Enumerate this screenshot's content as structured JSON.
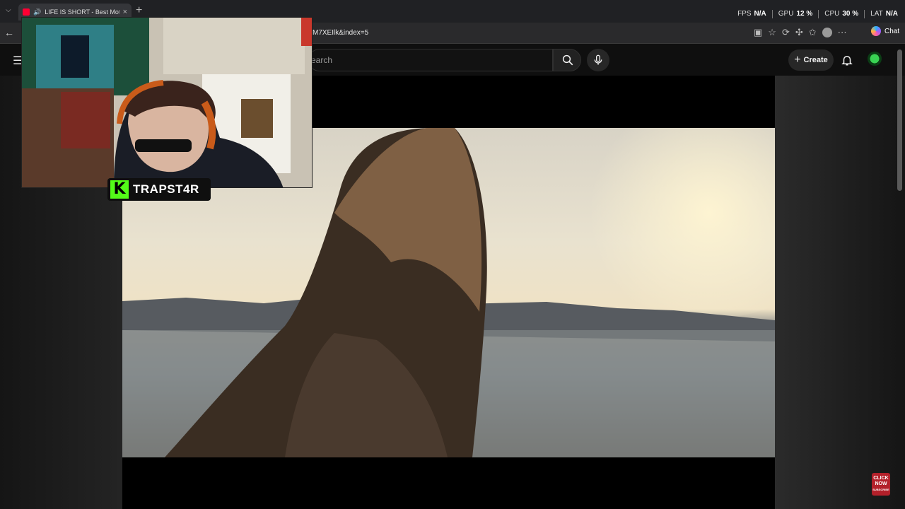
{
  "browser": {
    "tab_title": "LIFE IS SHORT - Best Motivati",
    "tab_close": "×",
    "new_tab": "+",
    "tab_list": "⌵",
    "url_fragment": "M7XEIlk&index=5",
    "chat_label": "Chat"
  },
  "perf_overlay": {
    "fps_label": "FPS",
    "fps_value": "N/A",
    "gpu_label": "GPU",
    "gpu_value": "12 %",
    "cpu_label": "CPU",
    "cpu_value": "30 %",
    "lat_label": "LAT",
    "lat_value": "N/A"
  },
  "youtube": {
    "search_placeholder": "earch",
    "create_label": "Create",
    "icons": [
      "menu-icon",
      "search-icon",
      "microphone-icon",
      "plus-icon",
      "bell-icon"
    ]
  },
  "overlay": {
    "streamer_name": "TRAPST4R",
    "logo_letter": "K",
    "click_now_line1": "CLICK",
    "click_now_line2": "NOW",
    "click_now_line3": "SUBSCRIBE"
  },
  "colors": {
    "kick_green": "#53fc18",
    "youtube_red": "#ff0033",
    "page_bg": "#0f0f0f"
  }
}
